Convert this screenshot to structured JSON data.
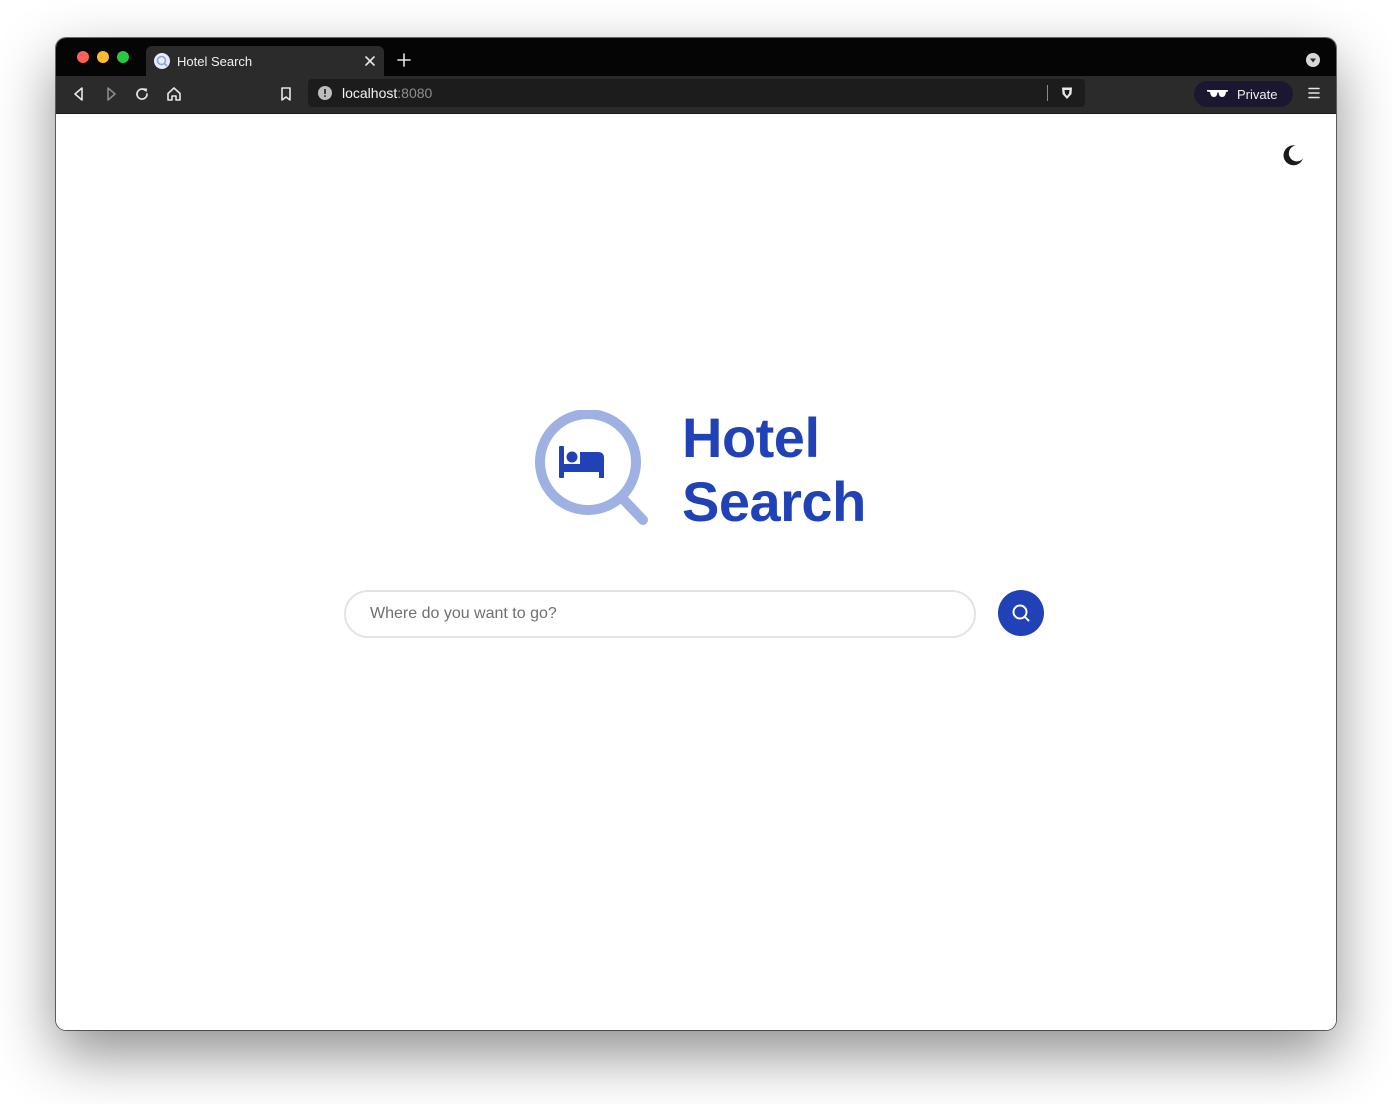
{
  "browser": {
    "tab": {
      "title": "Hotel Search",
      "favicon_icon": "search-icon",
      "close_icon": "close-icon"
    },
    "new_tab_icon": "plus-icon",
    "tab_dropdown_icon": "chevron-down-icon",
    "toolbar": {
      "back_icon": "back-icon",
      "forward_icon": "forward-icon",
      "reload_icon": "reload-icon",
      "home_icon": "home-icon",
      "bookmark_icon": "bookmark-icon",
      "menu_icon": "hamburger-menu-icon"
    },
    "url": {
      "host": "localhost",
      "port": ":8080",
      "info_icon": "info-icon",
      "shield_icon": "lion-shield-icon"
    },
    "private": {
      "label": "Private",
      "icon": "sunglasses-icon"
    }
  },
  "page": {
    "theme_toggle_icon": "moon-icon",
    "logo_icon": "magnifier-bed-icon",
    "brand": {
      "line1": "Hotel",
      "line2": "Search"
    },
    "search": {
      "placeholder": "Where do you want to go?",
      "value": "",
      "button_icon": "search-icon"
    }
  },
  "colors": {
    "brand": "#2042b6",
    "logo_light": "#9fb1e2",
    "chrome_dark": "#050505",
    "toolbar": "#2b2b2b",
    "private_pill": "#1b1730"
  }
}
